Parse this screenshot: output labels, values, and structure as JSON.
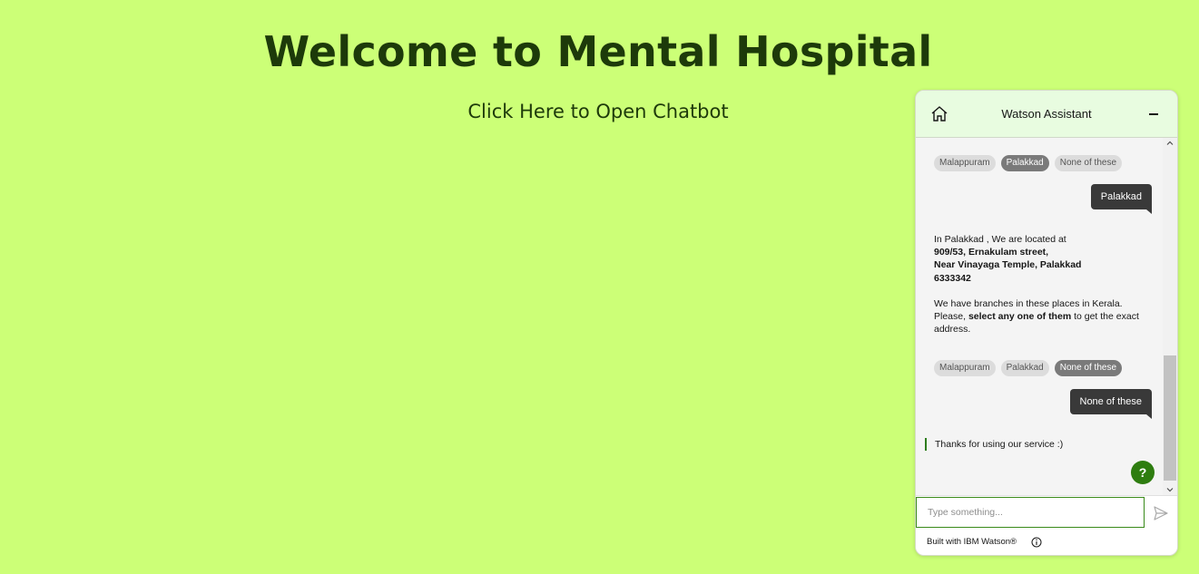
{
  "page": {
    "title": "Welcome to Mental Hospital",
    "open_link": "Click Here to Open Chatbot"
  },
  "chat": {
    "title": "Watson Assistant",
    "header_icons": {
      "home": "home-icon",
      "minimize": "minimize-icon"
    },
    "chips_first": [
      {
        "label": "Malappuram",
        "selected": false
      },
      {
        "label": "Palakkad",
        "selected": true
      },
      {
        "label": "None of these",
        "selected": false
      }
    ],
    "user_msg_1": "Palakkad",
    "bot_address": {
      "line1": "In Palakkad , We are located at",
      "line2": "909/53, Ernakulam street,",
      "line3": "Near Vinayaga Temple, Palakkad",
      "line4": "6333342",
      "line5": "We have branches in these places in Kerala.",
      "line6_prefix": "Please, ",
      "line6_bold": "select any one of them",
      "line6_suffix": " to get the exact",
      "line7": "address."
    },
    "chips_second": [
      {
        "label": "Malappuram",
        "selected": false
      },
      {
        "label": "Palakkad",
        "selected": false
      },
      {
        "label": "None of these",
        "selected": true
      }
    ],
    "user_msg_2": "None of these",
    "bot_thanks": "Thanks for using our service :)",
    "help_label": "?",
    "input_placeholder": "Type something...",
    "footer_text": "Built with IBM Watson®",
    "accent_color": "#2e7d10"
  }
}
